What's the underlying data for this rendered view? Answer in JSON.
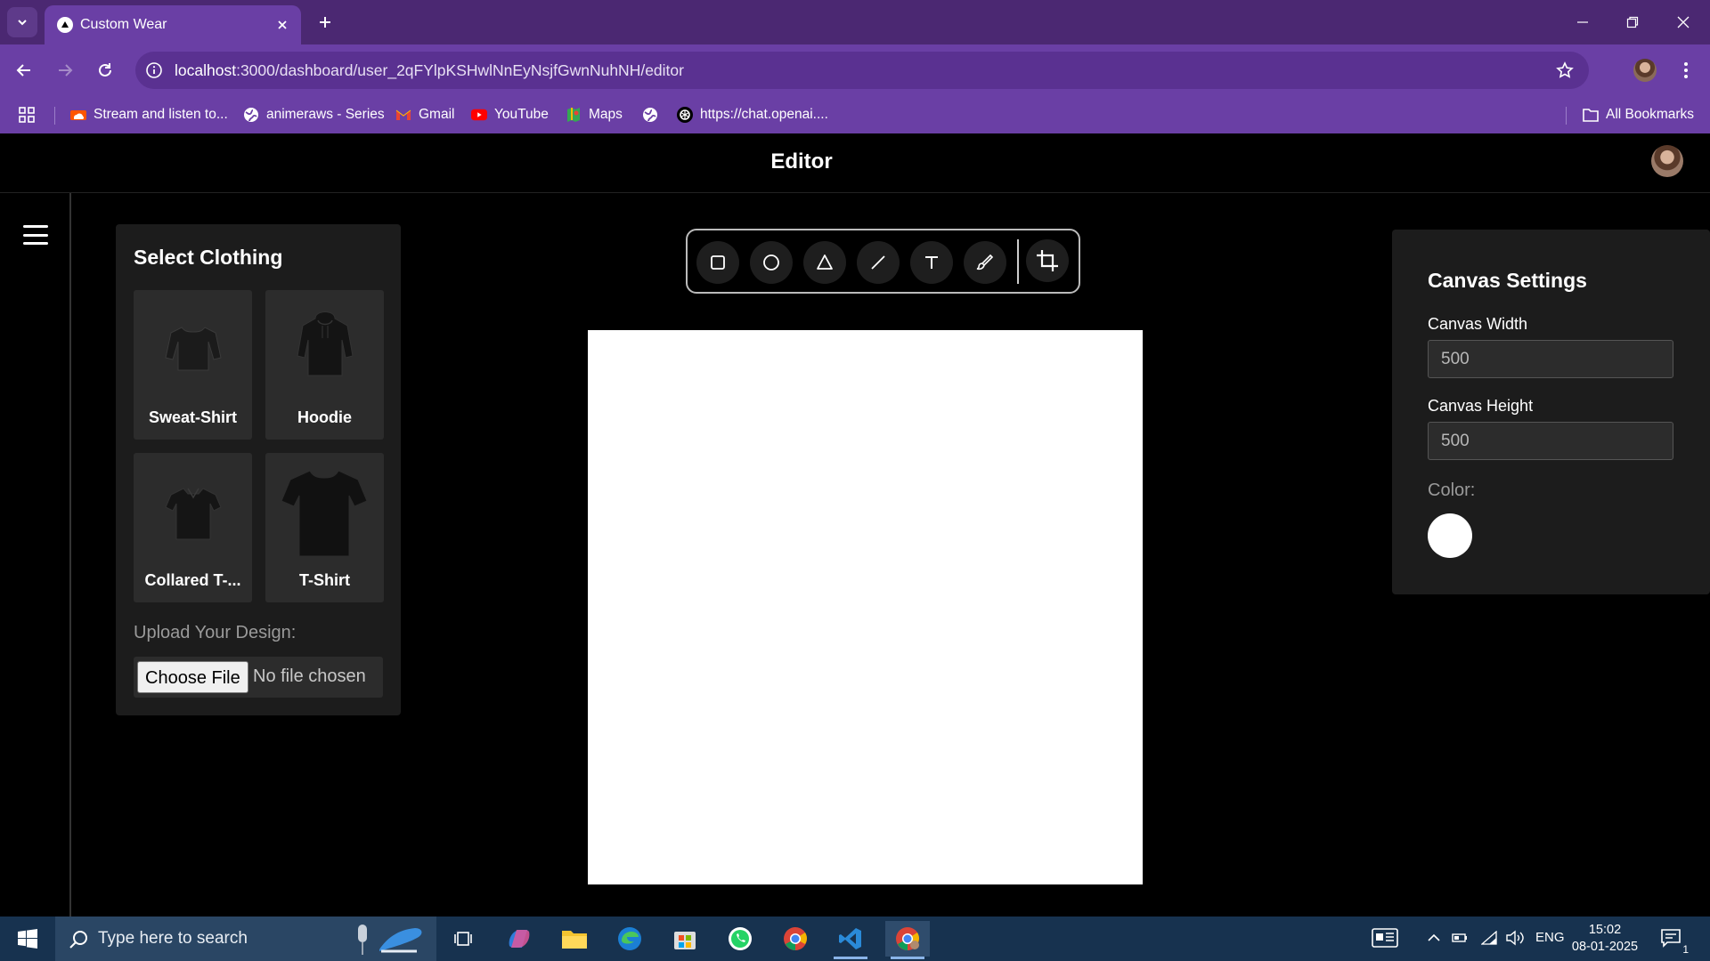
{
  "browser": {
    "tab_title": "Custom Wear",
    "url_host": "localhost",
    "url_rest": ":3000/dashboard/user_2qFYlpKSHwlNnEyNsjfGwnNuhNH/editor",
    "bookmarks": [
      {
        "label": "Stream and listen to...",
        "icon": "soundcloud-icon"
      },
      {
        "label": "animeraws - Series",
        "icon": "globe-icon"
      },
      {
        "label": "Gmail",
        "icon": "gmail-icon"
      },
      {
        "label": "YouTube",
        "icon": "youtube-icon"
      },
      {
        "label": "Maps",
        "icon": "maps-icon"
      },
      {
        "label": "",
        "icon": "globe-icon"
      },
      {
        "label": "https://chat.openai....",
        "icon": "openai-icon"
      }
    ],
    "all_bookmarks": "All Bookmarks"
  },
  "app": {
    "title": "Editor",
    "clothing": {
      "title": "Select Clothing",
      "items": [
        {
          "label": "Sweat-Shirt"
        },
        {
          "label": "Hoodie"
        },
        {
          "label": "Collared T-..."
        },
        {
          "label": "T-Shirt"
        }
      ],
      "upload_label": "Upload Your Design:",
      "choose_file": "Choose File",
      "no_file": "No file chosen"
    },
    "tools": [
      "rectangle-icon",
      "circle-icon",
      "triangle-icon",
      "line-icon",
      "text-icon",
      "brush-icon",
      "crop-icon"
    ],
    "settings": {
      "title": "Canvas Settings",
      "width_label": "Canvas Width",
      "width_value": "500",
      "height_label": "Canvas Height",
      "height_value": "500",
      "color_label": "Color:",
      "color_value": "#ffffff"
    }
  },
  "taskbar": {
    "search_placeholder": "Type here to search",
    "lang": "ENG",
    "time": "15:02",
    "date": "08-01-2025",
    "notifications": "1"
  }
}
